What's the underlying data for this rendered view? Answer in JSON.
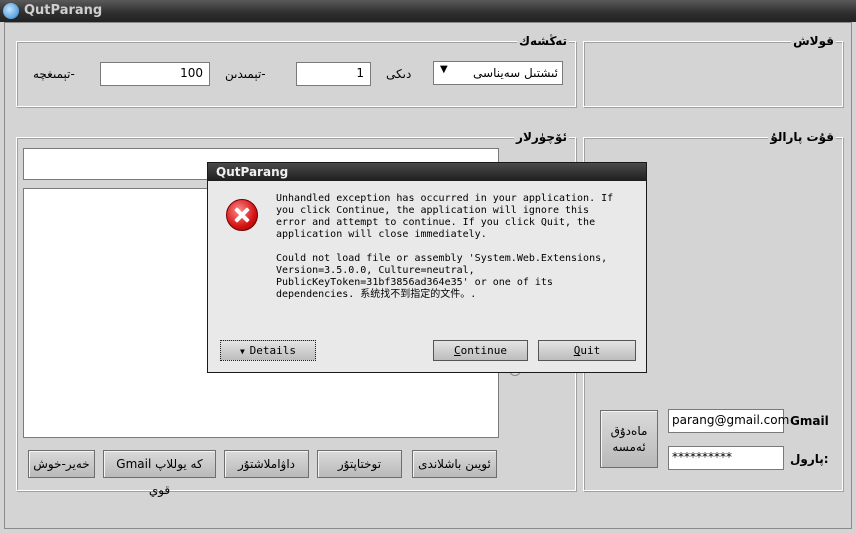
{
  "window": {
    "title": "QutParang"
  },
  "settings_group": {
    "label": "تەڭشەك",
    "dropdown_value": "ئىشتىل سەيناسى",
    "field1_value": "1",
    "field1_label": "دىكى",
    "field2_value": "100",
    "field2_label": "-تېمىدىن",
    "field3_label": "-تېمىغچە"
  },
  "log_group": {
    "label": "قولاش"
  },
  "results_group": {
    "label": "ئۆچۈرلار",
    "buttons": [
      "ئويىن باشلاندى",
      "توختاپتۇر",
      "داۋاملاشتۇر",
      "Gmail كە يوللاپ قوي",
      "خەير-خوش"
    ]
  },
  "account_group": {
    "label": "قۇت پارالۇ",
    "gmail_label": "Gmail",
    "gmail_value": "parang@gmail.com",
    "password_label": "پارول:",
    "password_value": "**********",
    "verify_button": "ماەدۇق ئەمسە"
  },
  "dialog": {
    "title": "QutParang",
    "message": "Unhandled exception has occurred in your application. If\nyou click Continue, the application will ignore this\nerror and attempt to continue. If you click Quit, the\napplication will close immediately.\n\nCould not load file or assembly 'System.Web.Extensions,\nVersion=3.5.0.0, Culture=neutral,\nPublicKeyToken=31bf3856ad364e35' or one of its\ndependencies. 系统找不到指定的文件。.",
    "details_button": "Details",
    "continue_button": "Continue",
    "quit_button": "Quit"
  }
}
